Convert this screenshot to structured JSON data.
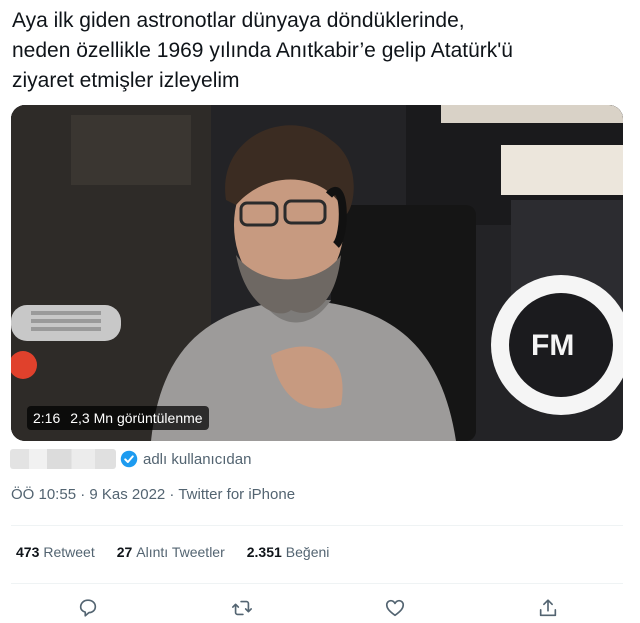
{
  "tweet": {
    "text": "Aya ilk giden astronotlar dünyaya döndüklerinde,\nneden özellikle 1969 yılında Anıtkabir’e gelip Atatürk'ü\nziyaret etmişler izleyelim"
  },
  "video": {
    "duration": "2:16",
    "views": "2,3 Mn görüntülenme",
    "logo_text": "FM"
  },
  "attribution": {
    "suffix": "adlı kullanıcıdan"
  },
  "meta": {
    "line": "ÖÖ 10:55 · 9 Kas 2022 · Twitter for iPhone"
  },
  "stats": {
    "retweets": {
      "count": "473",
      "label": "Retweet"
    },
    "quotes": {
      "count": "27",
      "label": "Alıntı Tweetler"
    },
    "likes": {
      "count": "2.351",
      "label": "Beğeni"
    }
  },
  "actions": [
    "reply-icon",
    "retweet-icon",
    "like-icon",
    "share-icon"
  ],
  "colors": {
    "text": "#0f1419",
    "secondary": "#536471",
    "verified": "#1d9bf0",
    "divider": "#eff3f4"
  }
}
